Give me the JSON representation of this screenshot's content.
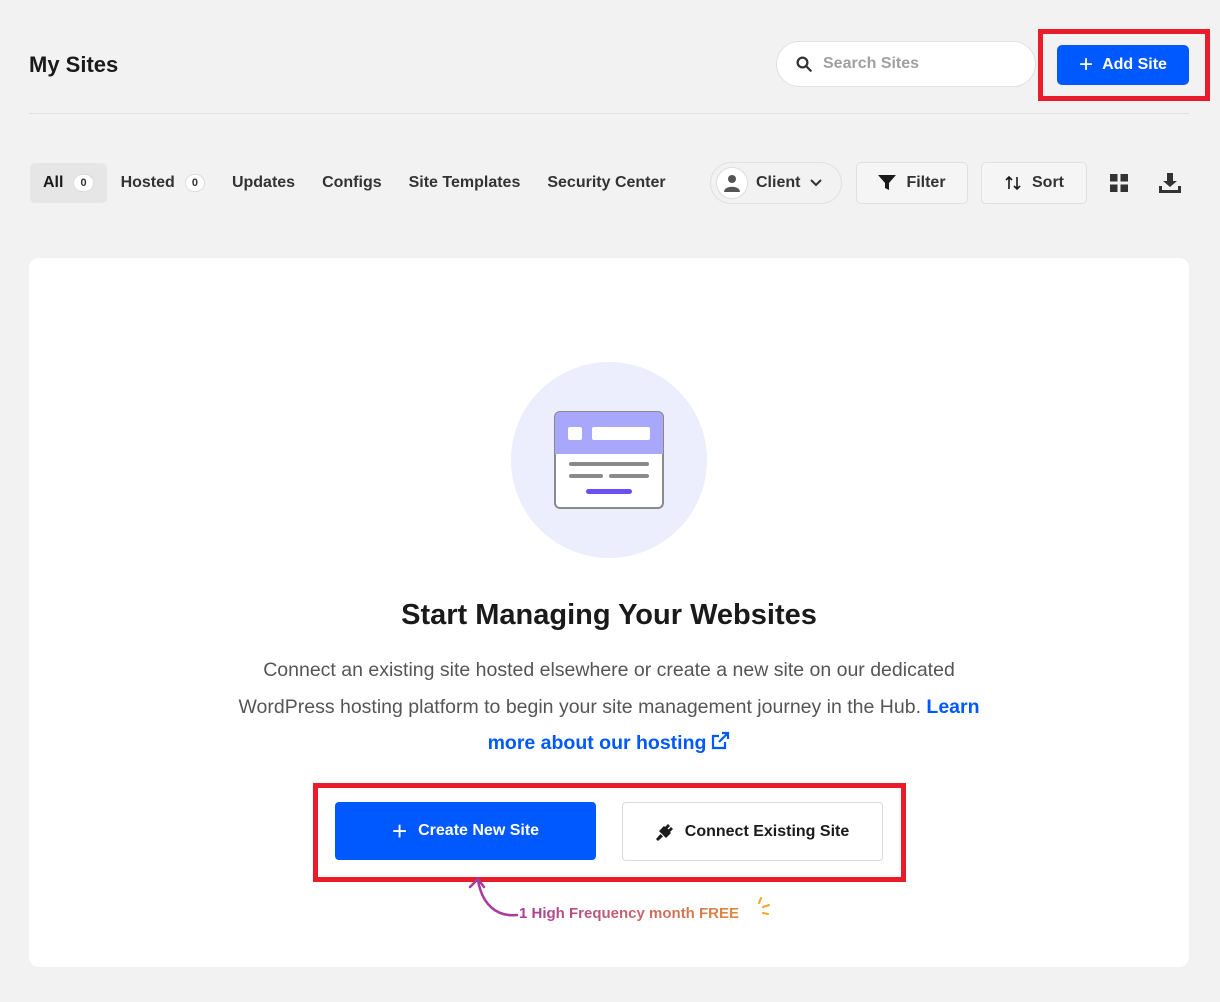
{
  "header": {
    "title": "My Sites",
    "search_placeholder": "Search Sites",
    "add_site_label": "Add Site"
  },
  "tabs": [
    {
      "label": "All",
      "count": "0",
      "active": true
    },
    {
      "label": "Hosted",
      "count": "0"
    },
    {
      "label": "Updates"
    },
    {
      "label": "Configs"
    },
    {
      "label": "Site Templates"
    },
    {
      "label": "Security Center"
    }
  ],
  "toolbar": {
    "client_label": "Client",
    "filter_label": "Filter",
    "sort_label": "Sort"
  },
  "empty_state": {
    "title": "Start Managing Your Websites",
    "description": "Connect an existing site hosted elsewhere or create a new site on our dedicated WordPress hosting platform to begin your site management journey in the Hub.",
    "learn_more_label": "Learn more about our hosting",
    "create_label": "Create New Site",
    "connect_label": "Connect Existing Site",
    "promo_text": "1 High Frequency month FREE"
  },
  "colors": {
    "accent": "#0059ff",
    "highlight": "#ea1b2a",
    "illustration_bg": "#ecedfd",
    "illustration_accent": "#a9a7fc"
  },
  "icons": {
    "search": "search-icon",
    "add": "plus-icon",
    "client": "user-icon",
    "chevron": "chevron-down-icon",
    "filter": "funnel-icon",
    "sort": "sort-arrows-icon",
    "grid": "grid-view-icon",
    "download": "download-icon",
    "external": "external-link-icon",
    "plug": "plug-icon"
  }
}
